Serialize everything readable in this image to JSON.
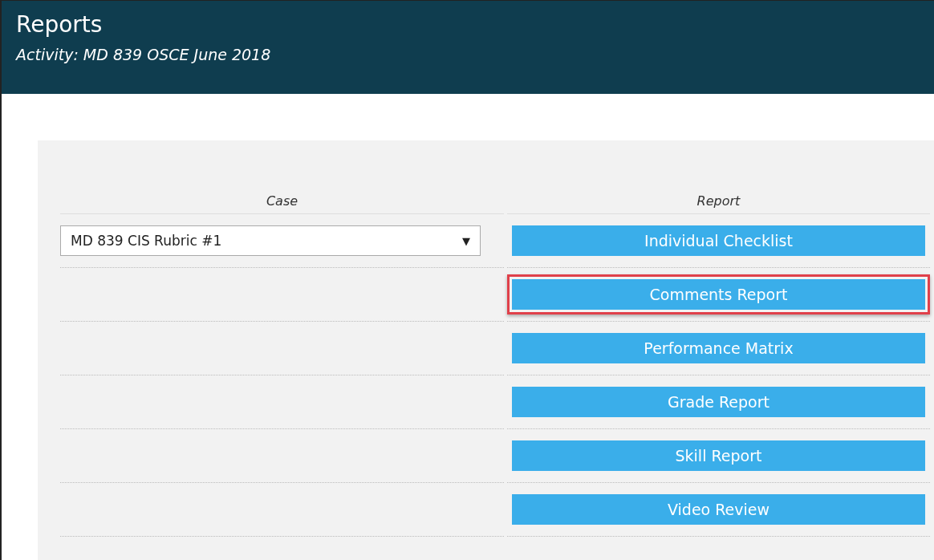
{
  "header": {
    "title": "Reports",
    "activity": "Activity: MD 839 OSCE June 2018"
  },
  "table": {
    "columns": [
      "Case",
      "Report"
    ],
    "case_select": {
      "value": "MD 839 CIS Rubric #1",
      "arrow": "▼"
    },
    "reports": [
      {
        "label": "Individual Checklist",
        "highlighted": false
      },
      {
        "label": "Comments Report",
        "highlighted": true
      },
      {
        "label": "Performance Matrix",
        "highlighted": false
      },
      {
        "label": "Grade Report",
        "highlighted": false
      },
      {
        "label": "Skill Report",
        "highlighted": false
      },
      {
        "label": "Video Review",
        "highlighted": false
      }
    ]
  }
}
